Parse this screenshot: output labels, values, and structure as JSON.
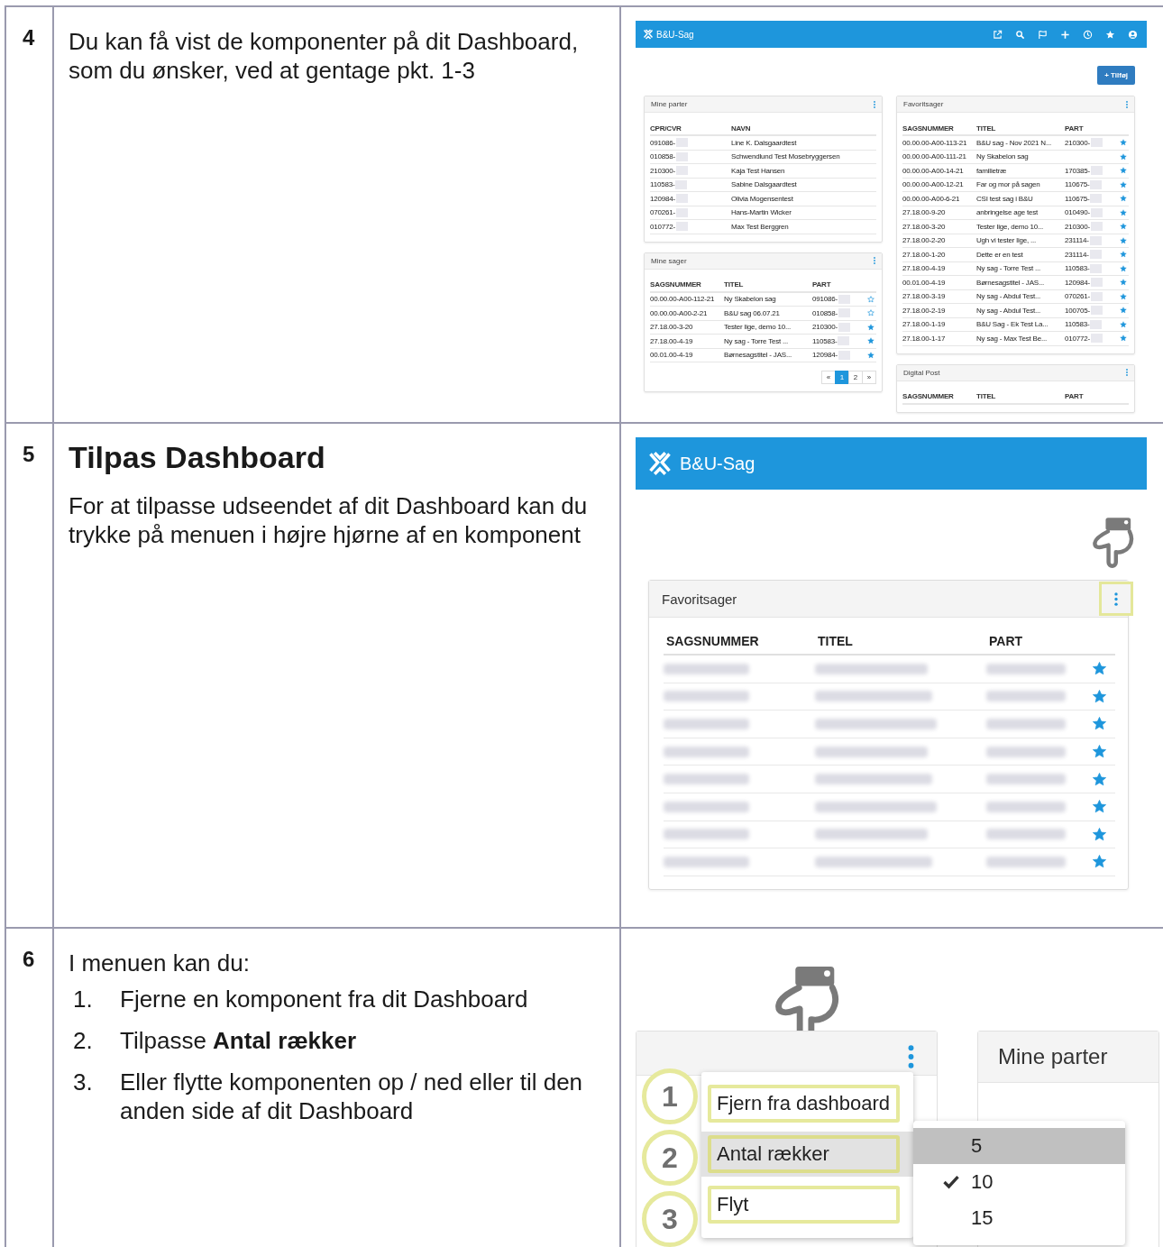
{
  "steps": [
    {
      "number": "4",
      "text": "Du kan få vist de komponenter på dit Dashboard, som du ønsker, ved at gentage pkt. 1-3",
      "screen": {
        "kind": "dashboard",
        "app_title": "B&U-Sag",
        "add_button": "+ Tilføj",
        "columns": [
          [
            {
              "title": "Mine parter",
              "columns": [
                {
                  "label": "CPR/CVR",
                  "redacted": true
                },
                {
                  "label": "NAVN",
                  "redacted": false
                }
              ],
              "stars": false,
              "rows": [
                {
                  "cells": [
                    "091086-",
                    "Line K. Dalsgaardtest"
                  ]
                },
                {
                  "cells": [
                    "010858-",
                    "Schwendlund Test Mosebryggersen"
                  ]
                },
                {
                  "cells": [
                    "210300-",
                    "Kaja Test Hansen"
                  ]
                },
                {
                  "cells": [
                    "110583-",
                    "Sabine Dalsgaardtest"
                  ]
                },
                {
                  "cells": [
                    "120984-",
                    "Olivia Mogensentest"
                  ]
                },
                {
                  "cells": [
                    "070261-",
                    "Hans-Martin Wicker"
                  ]
                },
                {
                  "cells": [
                    "010772-",
                    "Max Test Berggren"
                  ]
                }
              ]
            },
            {
              "title": "Mine sager",
              "columns": [
                {
                  "label": "SAGSNUMMER",
                  "redacted": false
                },
                {
                  "label": "TITEL",
                  "redacted": false
                },
                {
                  "label": "PART",
                  "redacted": true
                }
              ],
              "stars": true,
              "rows": [
                {
                  "cells": [
                    "00.00.00-A00-112-21",
                    "Ny Skabelon sag",
                    "091086-"
                  ],
                  "favorite": false
                },
                {
                  "cells": [
                    "00.00.00-A00-2-21",
                    "B&U sag 06.07.21",
                    "010858-"
                  ],
                  "favorite": false
                },
                {
                  "cells": [
                    "27.18.00-3-20",
                    "Tester lige, demo 10...",
                    "210300-"
                  ],
                  "favorite": true
                },
                {
                  "cells": [
                    "27.18.00-4-19",
                    "Ny sag - Torre Test ...",
                    "110583-"
                  ],
                  "favorite": true
                },
                {
                  "cells": [
                    "00.01.00-4-19",
                    "Børnesagstitel - JAS...",
                    "120984-"
                  ],
                  "favorite": true
                }
              ],
              "pagination": {
                "prev": "«",
                "next": "»",
                "pages": [
                  {
                    "label": "1",
                    "selected": true
                  },
                  {
                    "label": "2",
                    "selected": false
                  }
                ]
              }
            }
          ],
          [
            {
              "title": "Favoritsager",
              "columns": [
                {
                  "label": "SAGSNUMMER",
                  "redacted": false
                },
                {
                  "label": "TITEL",
                  "redacted": false
                },
                {
                  "label": "PART",
                  "redacted": true
                }
              ],
              "stars": true,
              "rows": [
                {
                  "cells": [
                    "00.00.00-A00-113-21",
                    "B&U sag - Nov 2021 N...",
                    "210300-"
                  ],
                  "favorite": true
                },
                {
                  "cells": [
                    "00.00.00-A00-111-21",
                    "Ny Skabelon sag",
                    ""
                  ],
                  "favorite": true
                },
                {
                  "cells": [
                    "00.00.00-A00-14-21",
                    "familietræ",
                    "170385-"
                  ],
                  "favorite": true
                },
                {
                  "cells": [
                    "00.00.00-A00-12-21",
                    "Far og mor på sagen",
                    "110675-"
                  ],
                  "favorite": true
                },
                {
                  "cells": [
                    "00.00.00-A00-6-21",
                    "CSI test sag i B&U",
                    "110675-"
                  ],
                  "favorite": true
                },
                {
                  "cells": [
                    "27.18.00-9-20",
                    "anbringelse age test",
                    "010490-"
                  ],
                  "favorite": true
                },
                {
                  "cells": [
                    "27.18.00-3-20",
                    "Tester lige, demo 10...",
                    "210300-"
                  ],
                  "favorite": true
                },
                {
                  "cells": [
                    "27.18.00-2-20",
                    "Ugh vi tester lige, ...",
                    "231114-"
                  ],
                  "favorite": true
                },
                {
                  "cells": [
                    "27.18.00-1-20",
                    "Dette er en test",
                    "231114-"
                  ],
                  "favorite": true
                },
                {
                  "cells": [
                    "27.18.00-4-19",
                    "Ny sag - Torre Test ...",
                    "110583-"
                  ],
                  "favorite": true
                },
                {
                  "cells": [
                    "00.01.00-4-19",
                    "Børnesagstitel - JAS...",
                    "120984-"
                  ],
                  "favorite": true
                },
                {
                  "cells": [
                    "27.18.00-3-19",
                    "Ny sag - Abdul Test...",
                    "070261-"
                  ],
                  "favorite": true
                },
                {
                  "cells": [
                    "27.18.00-2-19",
                    "Ny sag - Abdul Test...",
                    "100705-"
                  ],
                  "favorite": true
                },
                {
                  "cells": [
                    "27.18.00-1-19",
                    "B&U Sag - Ek Test La...",
                    "110583-"
                  ],
                  "favorite": true
                },
                {
                  "cells": [
                    "27.18.00-1-17",
                    "Ny sag - Max Test Be...",
                    "010772-"
                  ],
                  "favorite": true
                }
              ]
            },
            {
              "title": "Digital Post",
              "columns": [
                {
                  "label": "SAGSNUMMER",
                  "redacted": false
                },
                {
                  "label": "TITEL",
                  "redacted": false
                },
                {
                  "label": "PART",
                  "redacted": false
                }
              ]
            }
          ]
        ]
      }
    },
    {
      "number": "5",
      "heading": "Tilpas Dashboard",
      "text": "For at tilpasse udseendet af dit Dashboard kan du trykke på menuen i højre hjørne af en komponent",
      "screen": {
        "kind": "favorites",
        "app_title": "B&U-Sag",
        "panel": {
          "title": "Favoritsager",
          "columns": [
            "SAGSNUMMER",
            "TITEL",
            "PART"
          ],
          "rows": [
            {
              "favorite": true
            },
            {
              "favorite": true
            },
            {
              "favorite": true
            },
            {
              "favorite": true
            },
            {
              "favorite": true
            },
            {
              "favorite": true
            },
            {
              "favorite": true
            },
            {
              "favorite": true
            }
          ]
        }
      }
    },
    {
      "number": "6",
      "text": "I menuen kan du:",
      "list": [
        {
          "number": "1.",
          "text": "Fjerne en komponent fra dit Dashboard"
        },
        {
          "number": "2.",
          "text": "Tilpasse **Antal rækker**"
        },
        {
          "number": "3.",
          "text": "Eller flytte komponenten op / ned eller til den anden side af dit Dashboard"
        }
      ],
      "screen": {
        "kind": "menu",
        "menu": [
          {
            "marker": "1",
            "label": "Fjern fra dashboard",
            "selected": false
          },
          {
            "marker": "2",
            "label": "Antal rækker",
            "selected": true
          },
          {
            "marker": "3",
            "label": "Flyt",
            "selected": false
          }
        ],
        "submenu": [
          {
            "label": "5",
            "selected": true,
            "checked": false
          },
          {
            "label": "10",
            "selected": false,
            "checked": true
          },
          {
            "label": "15",
            "selected": false,
            "checked": false
          }
        ],
        "side_panel": {
          "title": "Mine parter"
        }
      }
    }
  ]
}
